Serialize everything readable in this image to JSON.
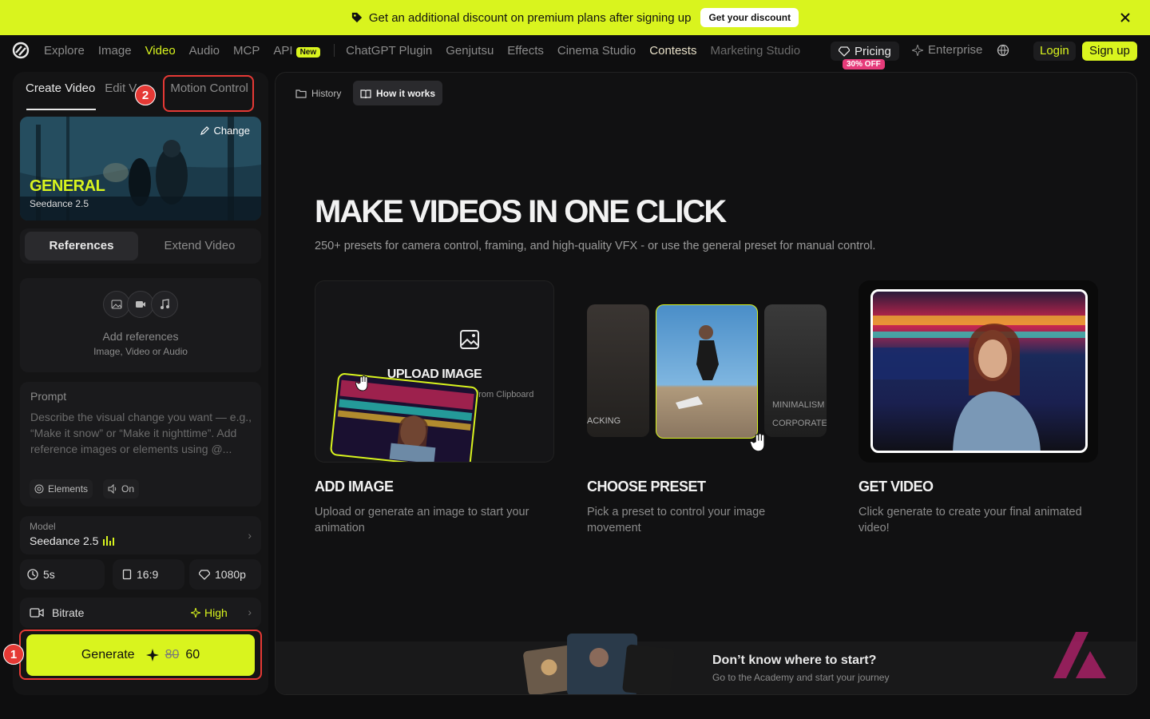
{
  "banner": {
    "text": "Get an additional discount on premium plans after signing up",
    "cta": "Get your discount"
  },
  "nav": {
    "items": [
      "Explore",
      "Image",
      "Video",
      "Audio",
      "MCP",
      "API"
    ],
    "new_badge": "New",
    "items2": [
      "ChatGPT Plugin",
      "Genjutsu",
      "Effects",
      "Cinema Studio",
      "Contests",
      "Marketing Studio"
    ],
    "pricing": "Pricing",
    "pricing_badge": "30% OFF",
    "enterprise": "Enterprise",
    "login": "Login",
    "signup": "Sign up"
  },
  "sidebar": {
    "tabs": [
      "Create Video",
      "Edit Video",
      "Motion Control"
    ],
    "tab_visible_2": "Edit V",
    "preset": {
      "title": "GENERAL",
      "subtitle": "Seedance 2.5",
      "change": "Change"
    },
    "mode": {
      "active": "References",
      "other": "Extend Video"
    },
    "refs": {
      "title": "Add references",
      "subtitle": "Image, Video or Audio"
    },
    "prompt": {
      "label": "Prompt",
      "placeholder": "Describe the visual change you want — e.g., “Make it snow” or “Make it nighttime”. Add reference images or elements using @...",
      "elements": "Elements",
      "sound": "On"
    },
    "model": {
      "label": "Model",
      "value": "Seedance 2.5"
    },
    "options": {
      "duration": "5s",
      "ratio": "16:9",
      "resolution": "1080p"
    },
    "bitrate": {
      "label": "Bitrate",
      "value": "High"
    },
    "generate": {
      "label": "Generate",
      "old_cost": "80",
      "cost": "60"
    },
    "markers": [
      "1",
      "2"
    ]
  },
  "main": {
    "tabs": [
      "History",
      "How it works"
    ],
    "headline": "MAKE VIDEOS IN ONE CLICK",
    "lead": "250+ presets for camera control, framing, and high-quality VFX - or use the general preset for manual control.",
    "upload": {
      "title": "UPLOAD IMAGE",
      "sub": "Paste from Clipboard"
    },
    "preset_labels": [
      "ACKING",
      "MINIMALISM",
      "CORPORATE"
    ],
    "steps": [
      {
        "title": "ADD IMAGE",
        "desc": "Upload or generate an image to start your animation"
      },
      {
        "title": "CHOOSE PRESET",
        "desc": "Pick a preset to control your image movement"
      },
      {
        "title": "GET VIDEO",
        "desc": "Click generate to create your final animated video!"
      }
    ],
    "academy": {
      "title": "Don’t know where to start?",
      "subtitle": "Go to the Academy and start your journey"
    }
  },
  "colors": {
    "accent": "#d9f41e",
    "annotation": "#e53935",
    "badge": "#e63b7a",
    "background": "#0e0e0f"
  }
}
